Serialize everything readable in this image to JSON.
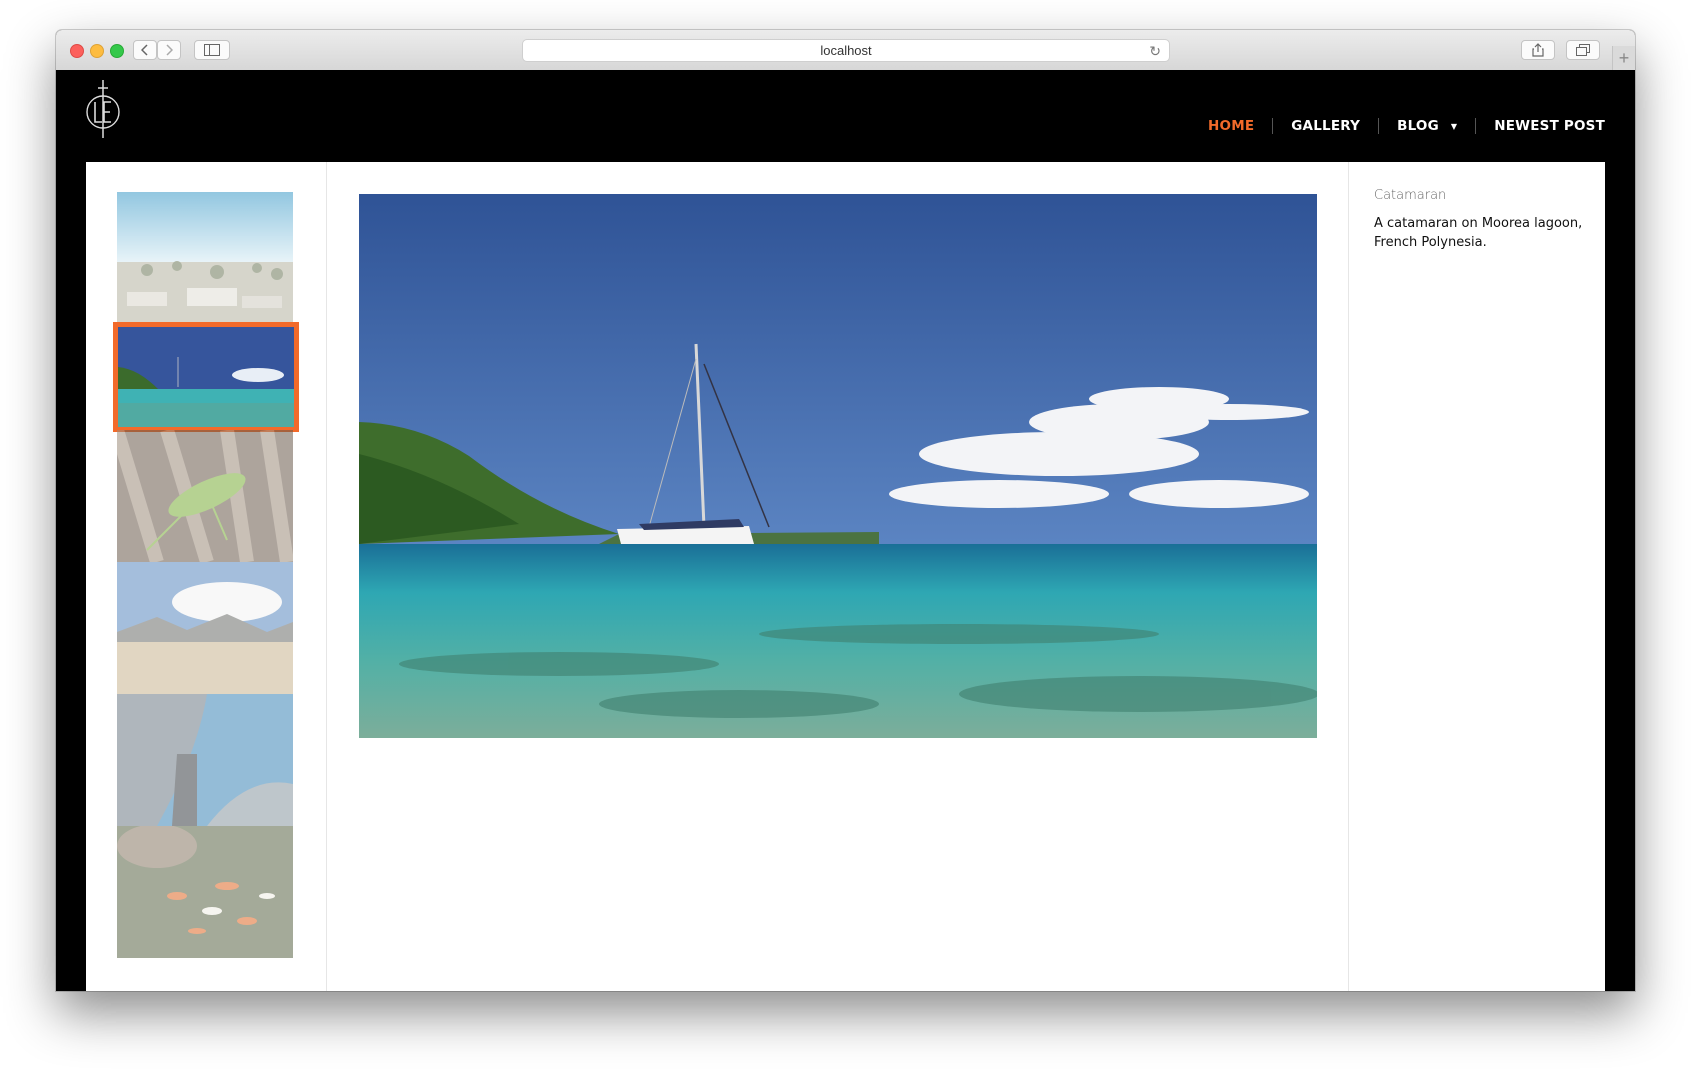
{
  "browser": {
    "address": "localhost",
    "reload_icon": "reload-icon",
    "back_icon": "chevron-left-icon",
    "forward_icon": "chevron-right-icon",
    "sidebar_icon": "sidebar-icon",
    "share_icon": "share-icon",
    "tabs_icon": "tabs-icon",
    "new_tab_icon": "plus-icon"
  },
  "site": {
    "logo_icon": "le-dagger-logo-icon",
    "nav": [
      {
        "label": "HOME",
        "active": true
      },
      {
        "label": "GALLERY",
        "active": false
      },
      {
        "label": "BLOG",
        "active": false,
        "has_dropdown": true
      },
      {
        "label": "NEWEST POST",
        "active": false
      }
    ],
    "accent_color": "#f26a2a"
  },
  "gallery": {
    "thumbnails": [
      {
        "subject": "beach-town-aerial",
        "active": false
      },
      {
        "subject": "catamaran-lagoon",
        "active": true
      },
      {
        "subject": "green-katydid-on-bark",
        "active": false
      },
      {
        "subject": "desert-mountains-clouds",
        "active": false
      },
      {
        "subject": "curved-metal-building",
        "active": false
      },
      {
        "subject": "koi-pond",
        "active": false
      }
    ],
    "selected": {
      "title": "Catamaran",
      "description": "A catamaran on Moorea lagoon, French Polynesia."
    }
  }
}
